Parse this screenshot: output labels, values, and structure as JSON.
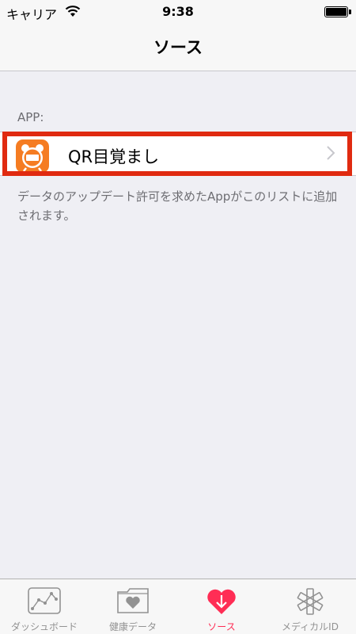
{
  "status_bar": {
    "carrier": "キャリア",
    "time": "9:38"
  },
  "nav": {
    "title": "ソース"
  },
  "section": {
    "header": "APP:",
    "rows": [
      {
        "label": "QR目覚まし",
        "icon": "alarm-clock-app-icon"
      }
    ],
    "footer": "データのアップデート許可を求めたAppがこのリストに追加されます。"
  },
  "tab_bar": {
    "tabs": [
      {
        "label": "ダッシュボード",
        "icon": "dashboard-chart-icon",
        "active": false
      },
      {
        "label": "健康データ",
        "icon": "health-data-folder-icon",
        "active": false
      },
      {
        "label": "ソース",
        "icon": "sources-heart-icon",
        "active": true
      },
      {
        "label": "メディカルID",
        "icon": "medical-id-asterisk-icon",
        "active": false
      }
    ]
  },
  "colors": {
    "accent": "#ff2d55",
    "highlight": "#e02a10",
    "app_icon": "#f57c22"
  }
}
